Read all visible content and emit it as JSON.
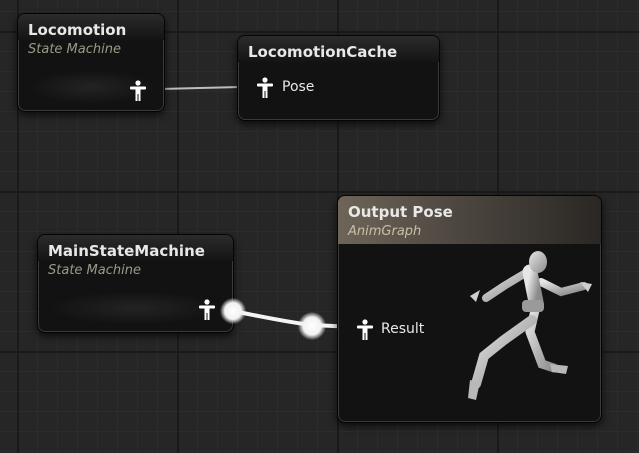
{
  "nodes": {
    "locomotion": {
      "title": "Locomotion",
      "subtitle": "State Machine"
    },
    "locomotion_cache": {
      "title": "LocomotionCache",
      "pin_label": "Pose"
    },
    "main_state_machine": {
      "title": "MainStateMachine",
      "subtitle": "State Machine"
    },
    "output_pose": {
      "title": "Output Pose",
      "subtitle": "AnimGraph",
      "pin_label": "Result"
    }
  },
  "icons": {
    "pose_pin": "pose-pin-icon",
    "running_figure": "running-mannequin-icon"
  },
  "colors": {
    "graph_background": "#262626",
    "node_body": "#121212",
    "title_text": "#e8e8e8",
    "subtitle_text": "#9c9a86",
    "output_header": "#6e6558",
    "wire": "#f2f2f2"
  }
}
